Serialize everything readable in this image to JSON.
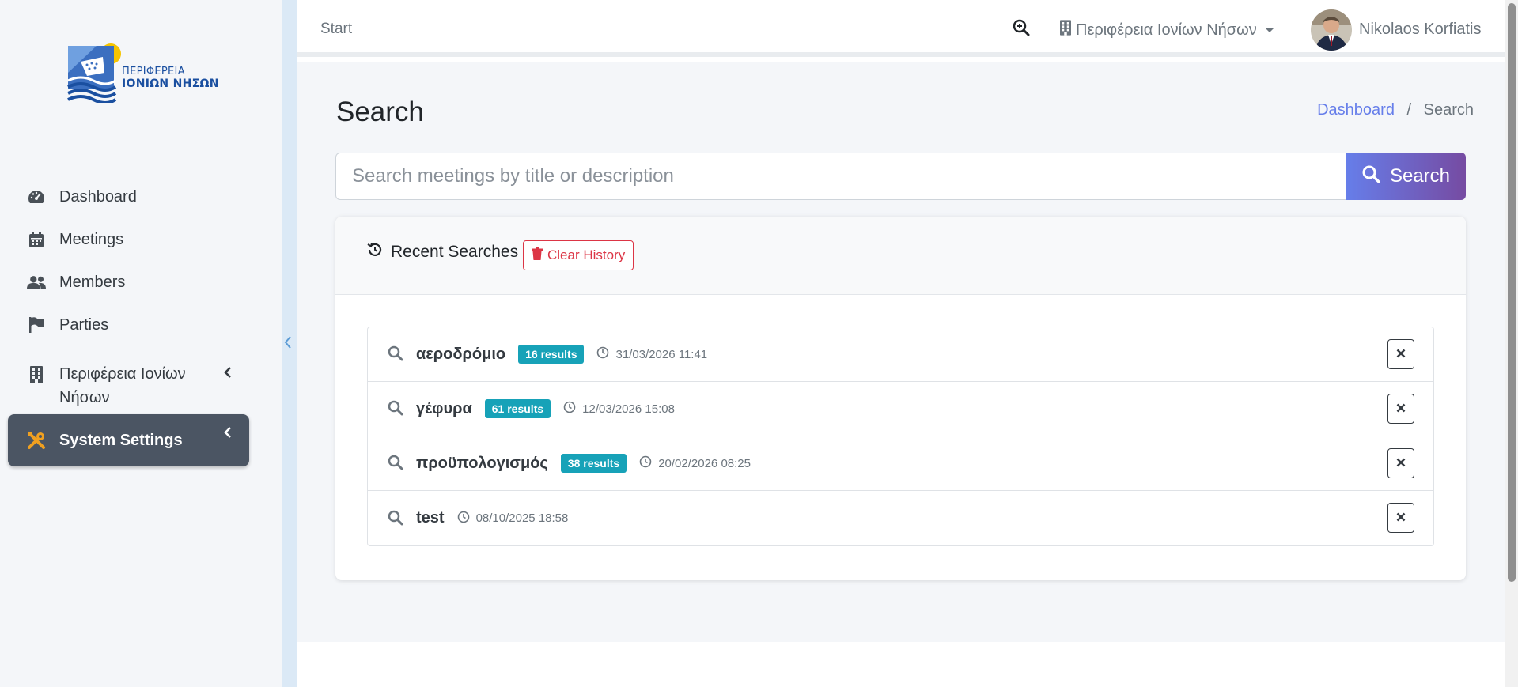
{
  "sidebar": {
    "logo": {
      "line1": "ΠΕΡΙΦΕΡΕΙΑ",
      "line2": "ΙΟΝΙΩΝ ΝΗΣΩΝ"
    },
    "items": [
      {
        "label": "Dashboard",
        "icon": "tachometer-icon"
      },
      {
        "label": "Meetings",
        "icon": "calendar-icon"
      },
      {
        "label": "Members",
        "icon": "users-icon"
      },
      {
        "label": "Parties",
        "icon": "flag-icon"
      },
      {
        "label": "Περιφέρεια Ιονίων Νήσων",
        "icon": "building-icon"
      },
      {
        "label": "System Settings",
        "icon": "tools-icon"
      }
    ],
    "collapse_icon": "chevron-left-icon"
  },
  "topbar": {
    "start_label": "Start",
    "region_label": "Περιφέρεια Ιονίων Νήσων",
    "user_name": "Nikolaos Korfiatis"
  },
  "main": {
    "title": "Search",
    "breadcrumb": {
      "home": "Dashboard",
      "current": "Search"
    },
    "search": {
      "placeholder": "Search meetings by title or description",
      "value": "",
      "button_label": "Search"
    },
    "recent": {
      "title": "Recent Searches",
      "clear_label": "Clear History",
      "items": [
        {
          "term": "αεροδρόμιο",
          "results": "16 results",
          "time": "31/03/2026 11:41"
        },
        {
          "term": "γέφυρα",
          "results": "61 results",
          "time": "12/03/2026 15:08"
        },
        {
          "term": "προϋπολογισμός",
          "results": "38 results",
          "time": "20/02/2026 08:25"
        },
        {
          "term": "test",
          "results": "",
          "time": "08/10/2025 18:58"
        }
      ]
    }
  },
  "colors": {
    "accent_start": "#667eea",
    "accent_end": "#764ba2",
    "badge": "#17a2b8",
    "danger": "#dc3545",
    "active_nav": "#4b5563"
  }
}
